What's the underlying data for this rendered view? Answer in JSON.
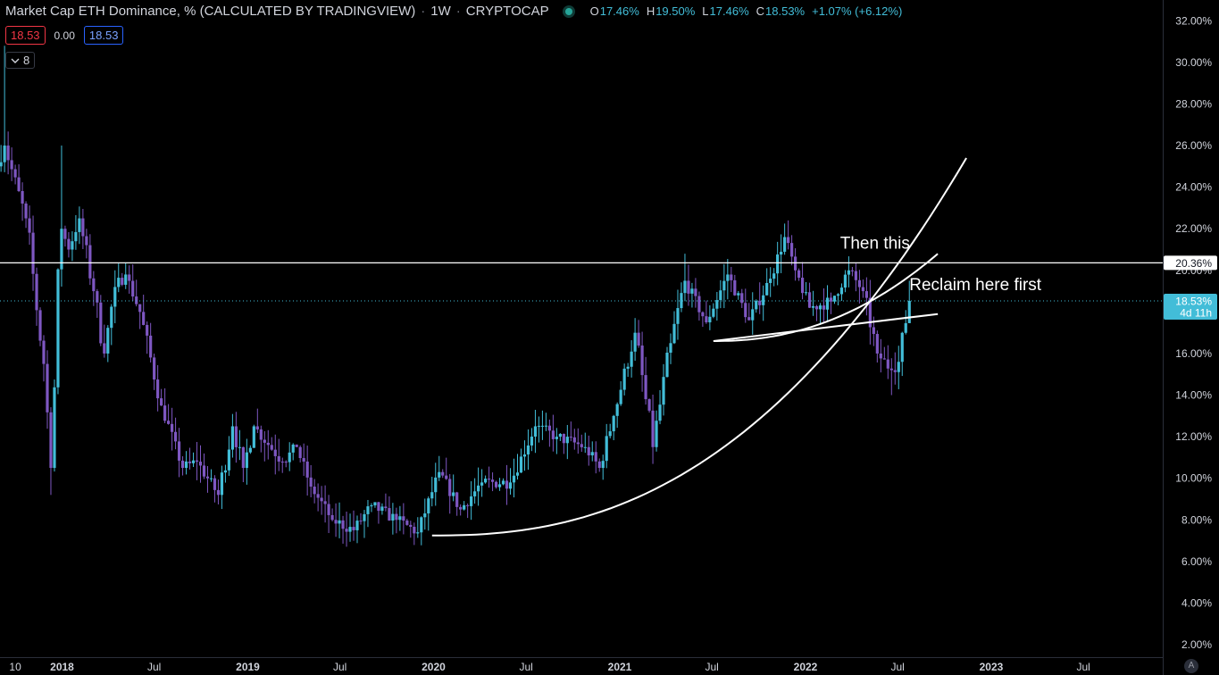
{
  "header": {
    "title": "Market Cap ETH Dominance, % (CALCULATED BY TRADINGVIEW)",
    "interval": "1W",
    "exchange": "CRYPTOCAP",
    "ohlc": {
      "o_label": "O",
      "o": "17.46%",
      "h_label": "H",
      "h": "19.50%",
      "l_label": "L",
      "l": "17.46%",
      "c_label": "C",
      "c": "18.53%",
      "change": "+1.07% (+6.12%)"
    }
  },
  "trade": {
    "sell": "18.53",
    "spread": "0.00",
    "buy": "18.53"
  },
  "indicators_toggle": {
    "icon": "chevron-down-icon",
    "count": "8"
  },
  "auto_scale": "A",
  "colors": {
    "background": "#000000",
    "axis_text": "#d1d4dc",
    "up_candle": "#42bdd8",
    "down_candle": "#7e57c2",
    "last_price": "#42bdd8",
    "line": "#ffffff"
  },
  "chart_data": {
    "type": "candlestick",
    "y_scale": "linear",
    "ylim": [
      1.4,
      33.0
    ],
    "xlim": [
      "2017-09-01",
      "2023-12-04"
    ],
    "y_ticks": [
      "2.00%",
      "4.00%",
      "6.00%",
      "8.00%",
      "10.00%",
      "12.00%",
      "14.00%",
      "16.00%",
      "18.00%",
      "20.00%",
      "22.00%",
      "24.00%",
      "26.00%",
      "28.00%",
      "30.00%",
      "32.00%"
    ],
    "x_ticks": [
      {
        "date": "2017-10-01",
        "label": "10",
        "bold": false
      },
      {
        "date": "2018-01-01",
        "label": "2018",
        "bold": true
      },
      {
        "date": "2018-07-01",
        "label": "Jul",
        "bold": false
      },
      {
        "date": "2019-01-01",
        "label": "2019",
        "bold": true
      },
      {
        "date": "2019-07-01",
        "label": "Jul",
        "bold": false
      },
      {
        "date": "2020-01-01",
        "label": "2020",
        "bold": true
      },
      {
        "date": "2020-07-01",
        "label": "Jul",
        "bold": false
      },
      {
        "date": "2021-01-01",
        "label": "2021",
        "bold": true
      },
      {
        "date": "2021-07-01",
        "label": "Jul",
        "bold": false
      },
      {
        "date": "2022-01-01",
        "label": "2022",
        "bold": true
      },
      {
        "date": "2022-07-01",
        "label": "Jul",
        "bold": false
      },
      {
        "date": "2023-01-01",
        "label": "2023",
        "bold": true
      },
      {
        "date": "2023-07-01",
        "label": "Jul",
        "bold": false
      }
    ],
    "series": [
      {
        "start": "2017-09-03",
        "weeks": 2,
        "from": 25.0,
        "to": 26.0
      },
      {
        "start": "2017-09-17",
        "weeks": 6,
        "from": 26.0,
        "to": 22.5
      },
      {
        "start": "2017-10-29",
        "weeks": 5,
        "from": 22.5,
        "to": 15.5
      },
      {
        "start": "2017-12-03",
        "weeks": 2,
        "from": 15.5,
        "to": 10.5
      },
      {
        "start": "2017-12-17",
        "weeks": 3,
        "from": 10.5,
        "to": 22.0
      },
      {
        "start": "2018-01-07",
        "weeks": 2,
        "from": 22.0,
        "to": 21.0
      },
      {
        "start": "2018-01-21",
        "weeks": 3,
        "from": 21.0,
        "to": 22.5
      },
      {
        "start": "2018-02-11",
        "weeks": 4,
        "from": 22.5,
        "to": 19.0
      },
      {
        "start": "2018-03-11",
        "weeks": 3,
        "from": 19.0,
        "to": 16.0
      },
      {
        "start": "2018-04-01",
        "weeks": 3,
        "from": 16.0,
        "to": 19.2
      },
      {
        "start": "2018-04-22",
        "weeks": 3,
        "from": 19.2,
        "to": 19.8
      },
      {
        "start": "2018-05-13",
        "weeks": 4,
        "from": 19.8,
        "to": 18.0
      },
      {
        "start": "2018-06-10",
        "weeks": 6,
        "from": 18.0,
        "to": 13.5
      },
      {
        "start": "2018-07-22",
        "weeks": 6,
        "from": 13.5,
        "to": 10.5
      },
      {
        "start": "2018-09-02",
        "weeks": 4,
        "from": 10.5,
        "to": 10.8
      },
      {
        "start": "2018-09-30",
        "weeks": 6,
        "from": 10.8,
        "to": 9.2
      },
      {
        "start": "2018-11-11",
        "weeks": 4,
        "from": 9.2,
        "to": 12.5
      },
      {
        "start": "2018-12-09",
        "weeks": 3,
        "from": 12.5,
        "to": 10.5
      },
      {
        "start": "2018-12-30",
        "weeks": 3,
        "from": 10.5,
        "to": 12.5
      },
      {
        "start": "2019-01-20",
        "weeks": 8,
        "from": 12.5,
        "to": 10.8
      },
      {
        "start": "2019-03-17",
        "weeks": 4,
        "from": 10.8,
        "to": 11.5
      },
      {
        "start": "2019-04-14",
        "weeks": 4,
        "from": 11.5,
        "to": 9.6
      },
      {
        "start": "2019-05-12",
        "weeks": 6,
        "from": 9.6,
        "to": 8.0
      },
      {
        "start": "2019-06-23",
        "weeks": 6,
        "from": 8.0,
        "to": 7.5
      },
      {
        "start": "2019-08-04",
        "weeks": 5,
        "from": 7.5,
        "to": 8.7
      },
      {
        "start": "2019-09-08",
        "weeks": 7,
        "from": 8.7,
        "to": 8.0
      },
      {
        "start": "2019-10-27",
        "weeks": 6,
        "from": 8.0,
        "to": 7.4
      },
      {
        "start": "2019-12-08",
        "weeks": 6,
        "from": 7.4,
        "to": 10.3
      },
      {
        "start": "2020-01-19",
        "weeks": 6,
        "from": 10.3,
        "to": 8.5
      },
      {
        "start": "2020-03-01",
        "weeks": 6,
        "from": 8.5,
        "to": 9.8
      },
      {
        "start": "2020-04-12",
        "weeks": 8,
        "from": 9.8,
        "to": 9.8
      },
      {
        "start": "2020-06-07",
        "weeks": 7,
        "from": 9.8,
        "to": 12.5
      },
      {
        "start": "2020-07-26",
        "weeks": 6,
        "from": 12.5,
        "to": 12.0
      },
      {
        "start": "2020-09-06",
        "weeks": 8,
        "from": 12.0,
        "to": 11.5
      },
      {
        "start": "2020-11-01",
        "weeks": 4,
        "from": 11.5,
        "to": 10.5
      },
      {
        "start": "2020-11-29",
        "weeks": 4,
        "from": 10.5,
        "to": 13.0
      },
      {
        "start": "2020-12-27",
        "weeks": 6,
        "from": 13.0,
        "to": 17.0
      },
      {
        "start": "2021-02-07",
        "weeks": 5,
        "from": 17.0,
        "to": 11.5
      },
      {
        "start": "2021-03-14",
        "weeks": 5,
        "from": 11.5,
        "to": 16.5
      },
      {
        "start": "2021-04-18",
        "weeks": 4,
        "from": 16.5,
        "to": 19.5
      },
      {
        "start": "2021-05-16",
        "weeks": 6,
        "from": 19.5,
        "to": 17.5
      },
      {
        "start": "2021-06-27",
        "weeks": 6,
        "from": 17.5,
        "to": 19.8
      },
      {
        "start": "2021-08-08",
        "weeks": 6,
        "from": 19.8,
        "to": 17.6
      },
      {
        "start": "2021-09-19",
        "weeks": 6,
        "from": 17.6,
        "to": 19.6
      },
      {
        "start": "2021-10-31",
        "weeks": 4,
        "from": 19.6,
        "to": 21.6
      },
      {
        "start": "2021-11-28",
        "weeks": 3,
        "from": 21.6,
        "to": 20.0
      },
      {
        "start": "2021-12-19",
        "weeks": 4,
        "from": 20.0,
        "to": 18.2
      },
      {
        "start": "2022-01-16",
        "weeks": 6,
        "from": 18.2,
        "to": 18.5
      },
      {
        "start": "2022-02-27",
        "weeks": 5,
        "from": 18.5,
        "to": 20.0
      },
      {
        "start": "2022-04-03",
        "weeks": 4,
        "from": 20.0,
        "to": 19.0
      },
      {
        "start": "2022-05-01",
        "weeks": 4,
        "from": 19.0,
        "to": 16.0
      },
      {
        "start": "2022-05-29",
        "weeks": 4,
        "from": 16.0,
        "to": 15.2
      },
      {
        "start": "2022-06-26",
        "weeks": 2,
        "from": 15.2,
        "to": 15.6
      },
      {
        "start": "2022-07-10",
        "weeks": 2,
        "from": 15.6,
        "to": 17.46
      }
    ],
    "last_candle": {
      "date": "2022-07-24",
      "open": 17.46,
      "high": 19.5,
      "low": 17.46,
      "close": 18.53
    },
    "drawings": {
      "hline": {
        "value": 20.36,
        "label": "20.36%"
      },
      "last_price_label": {
        "value": 18.53,
        "price": "18.53%",
        "countdown": "4d 11h"
      },
      "arc_main": {
        "x0": "2019-12-29",
        "x1": "2022-11-13",
        "y0": 7.25,
        "y1": 25.4
      },
      "arc_second": {
        "x0": "2021-07-04",
        "x1": "2022-09-18",
        "y0": 16.6,
        "y1": 20.8
      },
      "trendline": {
        "x0": "2021-07-04",
        "y0": 16.6,
        "x1": "2022-09-18",
        "y1": 17.9
      },
      "annotations": [
        {
          "text": "Then this",
          "date": "2022-03-10",
          "value": 21.05
        },
        {
          "text": "Reclaim here first",
          "date": "2022-07-24",
          "value": 19.05
        }
      ]
    }
  }
}
